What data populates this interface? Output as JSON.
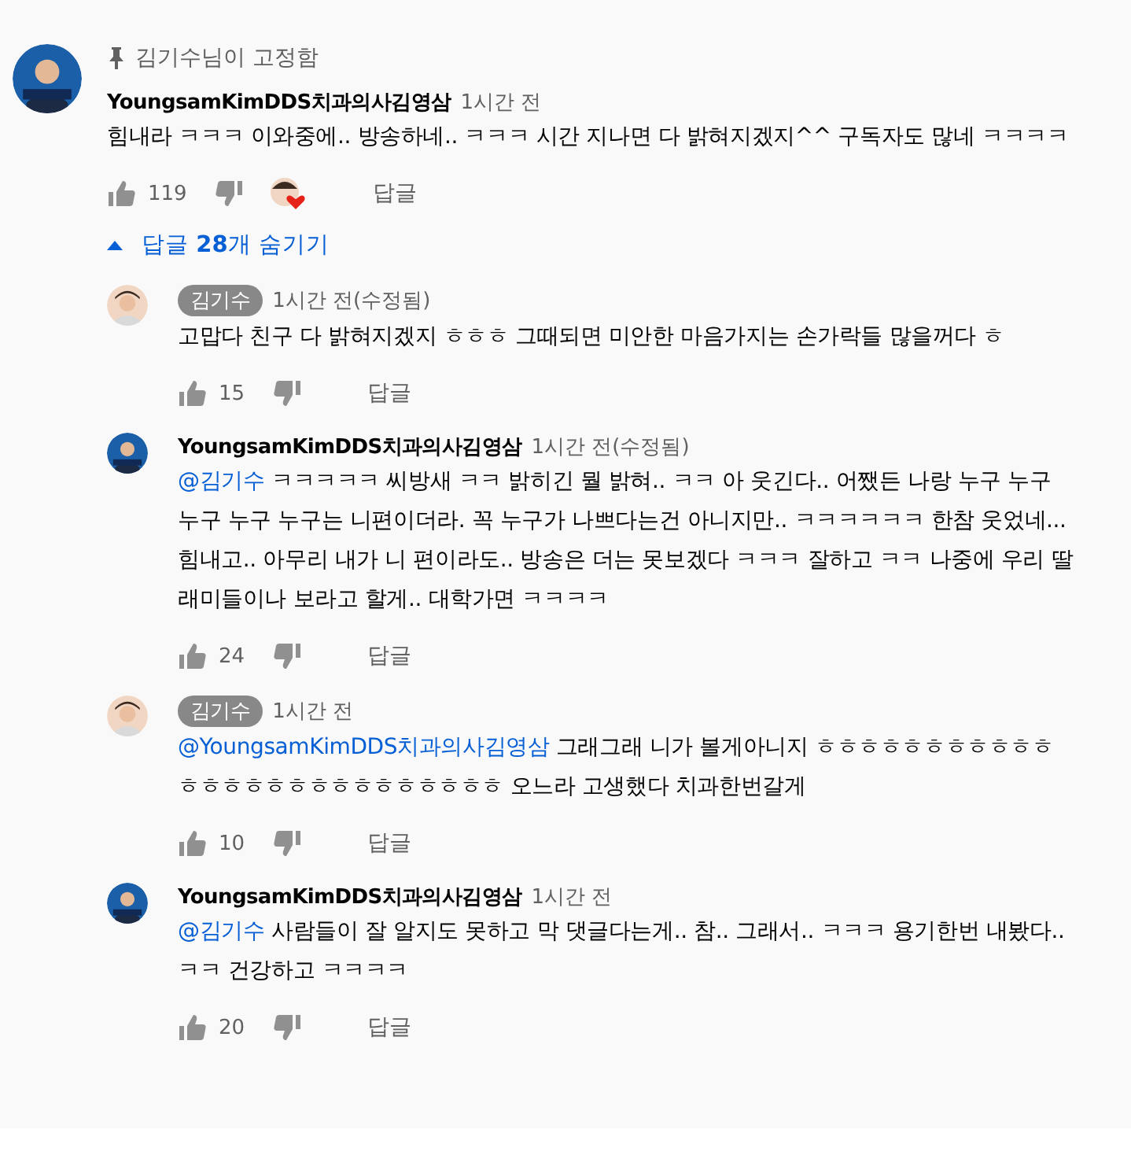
{
  "pinned": {
    "label": "김기수님이 고정함"
  },
  "comment": {
    "author": "YoungsamKimDDS치과의사김영삼",
    "author_badge": false,
    "time": "1시간 전",
    "text": "힘내라 ㅋㅋㅋ 이와중에.. 방송하네.. ㅋㅋㅋ 시간 지나면 다 밝혀지겠지^^ 구독자도 많네 ㅋㅋㅋㅋ",
    "likes": "119",
    "hearted": true,
    "reply_label": "답글"
  },
  "replies_toggle": {
    "label": "답글 **28**개 숨기기",
    "expanded": true
  },
  "replies": [
    {
      "author": "김기수",
      "author_badge": true,
      "time": "1시간 전(수정됨)",
      "text": "고맙다 친구 다 밝혀지겠지 ㅎㅎㅎ 그때되면 미안한 마음가지는 손가락들 많을꺼다 ㅎ",
      "likes": "15",
      "reply_label": "답글"
    },
    {
      "author": "YoungsamKimDDS치과의사김영삼",
      "author_badge": false,
      "time": "1시간 전(수정됨)",
      "mention": "@김기수",
      "text": "ㅋㅋㅋㅋㅋ 씨방새 ㅋㅋ 밝히긴 뭘 밝혀.. ㅋㅋ 아 웃긴다.. 어쨌든 나랑 누구 누구 누구 누구 누구는 니편이더라. 꼭 누구가 나쁘다는건 아니지만.. ㅋㅋㅋㅋㅋㅋ 한참 웃었네... 힘내고.. 아무리 내가 니 편이라도.. 방송은 더는 못보겠다 ㅋㅋㅋ 잘하고 ㅋㅋ 나중에 우리 딸래미들이나 보라고 할게.. 대학가면 ㅋㅋㅋㅋ",
      "likes": "24",
      "reply_label": "답글"
    },
    {
      "author": "김기수",
      "author_badge": true,
      "time": "1시간 전",
      "mention": "@YoungsamKimDDS치과의사김영삼",
      "text": " 그래그래 니가 볼게아니지 ㅎㅎㅎㅎㅎㅎㅎㅎㅎㅎㅎㅎㅎㅎㅎㅎㅎㅎㅎㅎㅎㅎㅎㅎㅎㅎ 오느라 고생했다 치과한번갈게",
      "likes": "10",
      "reply_label": "답글"
    },
    {
      "author": "YoungsamKimDDS치과의사김영삼",
      "author_badge": false,
      "time": "1시간 전",
      "mention": "@김기수",
      "text": "사람들이 잘 알지도 못하고 막 댓글다는게.. 참.. 그래서.. ㅋㅋㅋ 용기한번 내봤다..ㅋㅋ 건강하고 ㅋㅋㅋㅋ",
      "likes": "20",
      "reply_label": "답글"
    }
  ]
}
